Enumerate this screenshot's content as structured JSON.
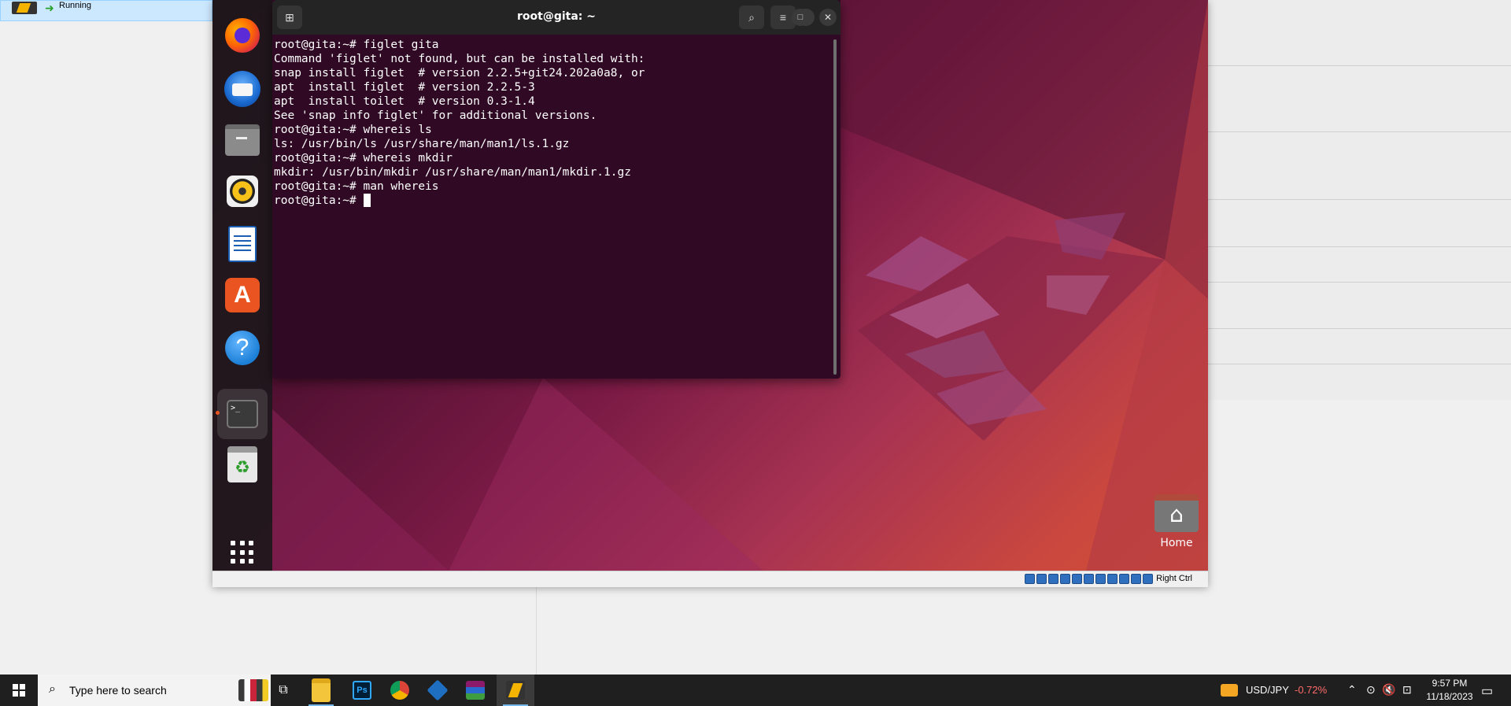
{
  "host": {
    "vm_status": "Running"
  },
  "vm": {
    "host_key": "Right Ctrl"
  },
  "dock": {
    "items": [
      "Firefox",
      "Thunderbird",
      "Files",
      "Rhythmbox",
      "LibreOffice Writer",
      "Ubuntu Software",
      "Help",
      "Terminal",
      "Trash",
      "Show Applications"
    ]
  },
  "terminal": {
    "title": "root@gita: ~",
    "lines": [
      "root@gita:~# figlet gita",
      "Command 'figlet' not found, but can be installed with:",
      "snap install figlet  # version 2.2.5+git24.202a0a8, or",
      "apt  install figlet  # version 2.2.5-3",
      "apt  install toilet  # version 0.3-1.4",
      "See 'snap info figlet' for additional versions.",
      "root@gita:~# whereis ls",
      "ls: /usr/bin/ls /usr/share/man/man1/ls.1.gz",
      "root@gita:~# whereis mkdir",
      "mkdir: /usr/bin/mkdir /usr/share/man/man1/mkdir.1.gz",
      "root@gita:~# man whereis",
      "root@gita:~# "
    ]
  },
  "desktop": {
    "home_label": "Home"
  },
  "taskbar": {
    "search_placeholder": "Type here to search",
    "ticker_symbol": "USD/JPY",
    "ticker_change": "-0.72%",
    "ticker_color": "#ff6b6b",
    "time": "9:57 PM",
    "date": "11/18/2023"
  }
}
